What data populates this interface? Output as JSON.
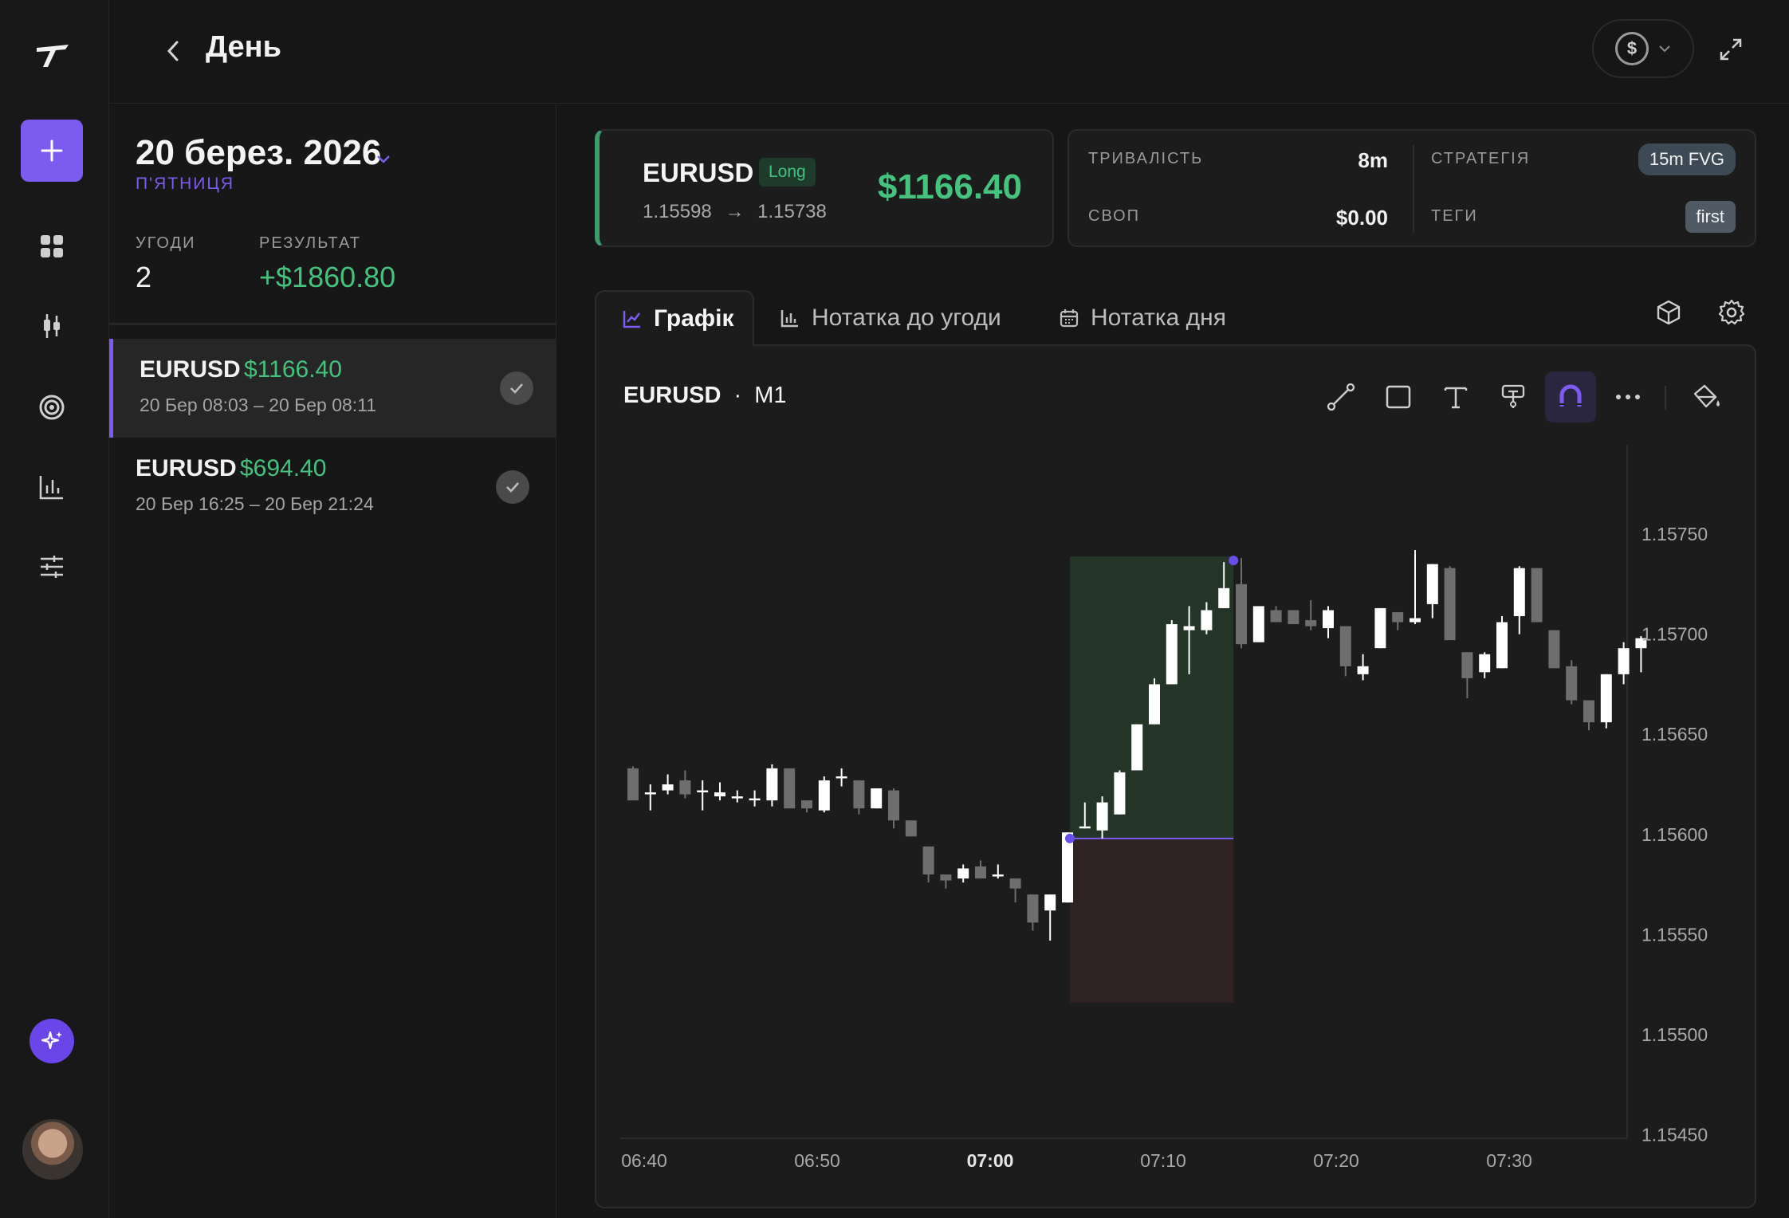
{
  "header": {
    "title": "День",
    "currency_symbol": "$"
  },
  "day": {
    "date": "20 берез. 2026",
    "weekday": "П'ЯТНИЦЯ",
    "stats": {
      "trades_label": "УГОДИ",
      "trades_value": "2",
      "result_label": "РЕЗУЛЬТАТ",
      "result_value": "+$1860.80"
    },
    "trades": [
      {
        "symbol": "EURUSD",
        "pnl": "$1166.40",
        "range": "20 Бер 08:03 – 20 Бер 08:11",
        "selected": true
      },
      {
        "symbol": "EURUSD",
        "pnl": "$694.40",
        "range": "20 Бер 16:25 – 20 Бер 21:24",
        "selected": false
      }
    ]
  },
  "trade": {
    "symbol": "EURUSD",
    "direction": "Long",
    "entry": "1.15598",
    "arrow": "→",
    "exit": "1.15738",
    "pnl": "$1166.40",
    "duration_label": "ТРИВАЛІСТЬ",
    "duration_value": "8m",
    "swap_label": "СВОП",
    "swap_value": "$0.00",
    "strategy_label": "СТРАТЕГІЯ",
    "strategy_value": "15m FVG",
    "tags_label": "ТЕГИ",
    "tags_value": "first"
  },
  "tabs": [
    {
      "label": "Графік",
      "active": true
    },
    {
      "label": "Нотатка до угоди",
      "active": false
    },
    {
      "label": "Нотатка дня",
      "active": false
    }
  ],
  "chart": {
    "symbol": "EURUSD",
    "separator": "·",
    "timeframe": "M1"
  },
  "colors": {
    "accent": "#7C5CF0",
    "profit": "#46C27F",
    "bull_candle": "#FFFFFF",
    "bear_candle": "#6E6E6E",
    "profit_zone": "#243528",
    "loss_zone": "#2E2222"
  },
  "chart_data": {
    "type": "candlestick",
    "x_tick_labels": [
      "06:40",
      "06:50",
      "07:00",
      "07:10",
      "07:20",
      "07:30"
    ],
    "x_tick_emphasis": "07:00",
    "y_tick_labels": [
      "1.15750",
      "1.15700",
      "1.15650",
      "1.15600",
      "1.15550",
      "1.15500",
      "1.15450"
    ],
    "ylim": [
      1.1545,
      1.1578
    ],
    "candles": [
      {
        "o": 1.15633,
        "h": 1.15634,
        "c": 1.15617,
        "l": 1.15617
      },
      {
        "o": 1.1562,
        "h": 1.15625,
        "c": 1.15621,
        "l": 1.15612
      },
      {
        "o": 1.15622,
        "h": 1.1563,
        "c": 1.15625,
        "l": 1.1562
      },
      {
        "o": 1.15627,
        "h": 1.15632,
        "c": 1.1562,
        "l": 1.15618
      },
      {
        "o": 1.15622,
        "h": 1.15627,
        "c": 1.15622,
        "l": 1.15612
      },
      {
        "o": 1.15619,
        "h": 1.15626,
        "c": 1.15621,
        "l": 1.15617
      },
      {
        "o": 1.15619,
        "h": 1.15622,
        "c": 1.15619,
        "l": 1.15616
      },
      {
        "o": 1.15617,
        "h": 1.15622,
        "c": 1.15618,
        "l": 1.15614
      },
      {
        "o": 1.15617,
        "h": 1.15635,
        "c": 1.15633,
        "l": 1.15614
      },
      {
        "o": 1.15633,
        "h": 1.15633,
        "c": 1.15613,
        "l": 1.15613
      },
      {
        "o": 1.15617,
        "h": 1.15617,
        "c": 1.15613,
        "l": 1.15611
      },
      {
        "o": 1.15612,
        "h": 1.15629,
        "c": 1.15627,
        "l": 1.15611
      },
      {
        "o": 1.15629,
        "h": 1.15633,
        "c": 1.15629,
        "l": 1.15624
      },
      {
        "o": 1.15627,
        "h": 1.15627,
        "c": 1.15613,
        "l": 1.1561
      },
      {
        "o": 1.15613,
        "h": 1.15623,
        "c": 1.15623,
        "l": 1.15613
      },
      {
        "o": 1.15622,
        "h": 1.15623,
        "c": 1.15607,
        "l": 1.15603
      },
      {
        "o": 1.15607,
        "h": 1.15607,
        "c": 1.15599,
        "l": 1.15599
      },
      {
        "o": 1.15594,
        "h": 1.15594,
        "c": 1.1558,
        "l": 1.15576
      },
      {
        "o": 1.1558,
        "h": 1.1558,
        "c": 1.15577,
        "l": 1.15573
      },
      {
        "o": 1.15578,
        "h": 1.15585,
        "c": 1.15583,
        "l": 1.15576
      },
      {
        "o": 1.15584,
        "h": 1.15587,
        "c": 1.15578,
        "l": 1.15578
      },
      {
        "o": 1.15579,
        "h": 1.15585,
        "c": 1.1558,
        "l": 1.15578
      },
      {
        "o": 1.15578,
        "h": 1.15578,
        "c": 1.15573,
        "l": 1.15566
      },
      {
        "o": 1.1557,
        "h": 1.1557,
        "c": 1.15556,
        "l": 1.15552
      },
      {
        "o": 1.15562,
        "h": 1.1557,
        "c": 1.1557,
        "l": 1.15547
      },
      {
        "o": 1.15566,
        "h": 1.15601,
        "c": 1.15601,
        "l": 1.15566
      },
      {
        "o": 1.15603,
        "h": 1.15616,
        "c": 1.15604,
        "l": 1.15603
      },
      {
        "o": 1.15602,
        "h": 1.15619,
        "c": 1.15616,
        "l": 1.15598
      },
      {
        "o": 1.1561,
        "h": 1.15632,
        "c": 1.15631,
        "l": 1.1561
      },
      {
        "o": 1.15632,
        "h": 1.15655,
        "c": 1.15655,
        "l": 1.15632
      },
      {
        "o": 1.15655,
        "h": 1.15678,
        "c": 1.15675,
        "l": 1.15655
      },
      {
        "o": 1.15675,
        "h": 1.15707,
        "c": 1.15705,
        "l": 1.15675
      },
      {
        "o": 1.15702,
        "h": 1.15714,
        "c": 1.15704,
        "l": 1.1568
      },
      {
        "o": 1.15702,
        "h": 1.15716,
        "c": 1.15712,
        "l": 1.157
      },
      {
        "o": 1.15713,
        "h": 1.15736,
        "c": 1.15723,
        "l": 1.15713
      },
      {
        "o": 1.15725,
        "h": 1.15738,
        "c": 1.15695,
        "l": 1.15693
      },
      {
        "o": 1.15696,
        "h": 1.15702,
        "c": 1.15714,
        "l": 1.15696
      },
      {
        "o": 1.15712,
        "h": 1.15714,
        "c": 1.15706,
        "l": 1.15706
      },
      {
        "o": 1.15712,
        "h": 1.15712,
        "c": 1.15705,
        "l": 1.15705
      },
      {
        "o": 1.15707,
        "h": 1.15717,
        "c": 1.15704,
        "l": 1.15702
      },
      {
        "o": 1.15703,
        "h": 1.15714,
        "c": 1.15712,
        "l": 1.15698
      },
      {
        "o": 1.15704,
        "h": 1.15704,
        "c": 1.15684,
        "l": 1.15679
      },
      {
        "o": 1.1568,
        "h": 1.1569,
        "c": 1.15684,
        "l": 1.15677
      },
      {
        "o": 1.15693,
        "h": 1.15713,
        "c": 1.15713,
        "l": 1.15693
      },
      {
        "o": 1.15711,
        "h": 1.15711,
        "c": 1.15706,
        "l": 1.15702
      },
      {
        "o": 1.15706,
        "h": 1.15742,
        "c": 1.15708,
        "l": 1.15705
      },
      {
        "o": 1.15715,
        "h": 1.15735,
        "c": 1.15735,
        "l": 1.15708
      },
      {
        "o": 1.15733,
        "h": 1.15734,
        "c": 1.15697,
        "l": 1.15697
      },
      {
        "o": 1.15691,
        "h": 1.15691,
        "c": 1.15678,
        "l": 1.15668
      },
      {
        "o": 1.15681,
        "h": 1.15691,
        "c": 1.1569,
        "l": 1.15678
      },
      {
        "o": 1.15683,
        "h": 1.15709,
        "c": 1.15706,
        "l": 1.15683
      },
      {
        "o": 1.15709,
        "h": 1.15734,
        "c": 1.15733,
        "l": 1.157
      },
      {
        "o": 1.15733,
        "h": 1.15733,
        "c": 1.15706,
        "l": 1.15706
      },
      {
        "o": 1.15702,
        "h": 1.15702,
        "c": 1.15683,
        "l": 1.15683
      },
      {
        "o": 1.15684,
        "h": 1.15687,
        "c": 1.15667,
        "l": 1.15665
      },
      {
        "o": 1.15667,
        "h": 1.15667,
        "c": 1.15656,
        "l": 1.15652
      },
      {
        "o": 1.15656,
        "h": 1.1568,
        "c": 1.1568,
        "l": 1.15653
      },
      {
        "o": 1.1568,
        "h": 1.15696,
        "c": 1.15693,
        "l": 1.15675
      },
      {
        "o": 1.15693,
        "h": 1.15699,
        "c": 1.15698,
        "l": 1.15681
      }
    ],
    "entry_price": 1.15598,
    "exit_price": 1.15738,
    "profit_zone": {
      "from": 1.15598,
      "to": 1.15738
    },
    "loss_zone": {
      "from": 1.15516,
      "to": 1.15598
    },
    "trade_candle_range": [
      25,
      34
    ]
  }
}
